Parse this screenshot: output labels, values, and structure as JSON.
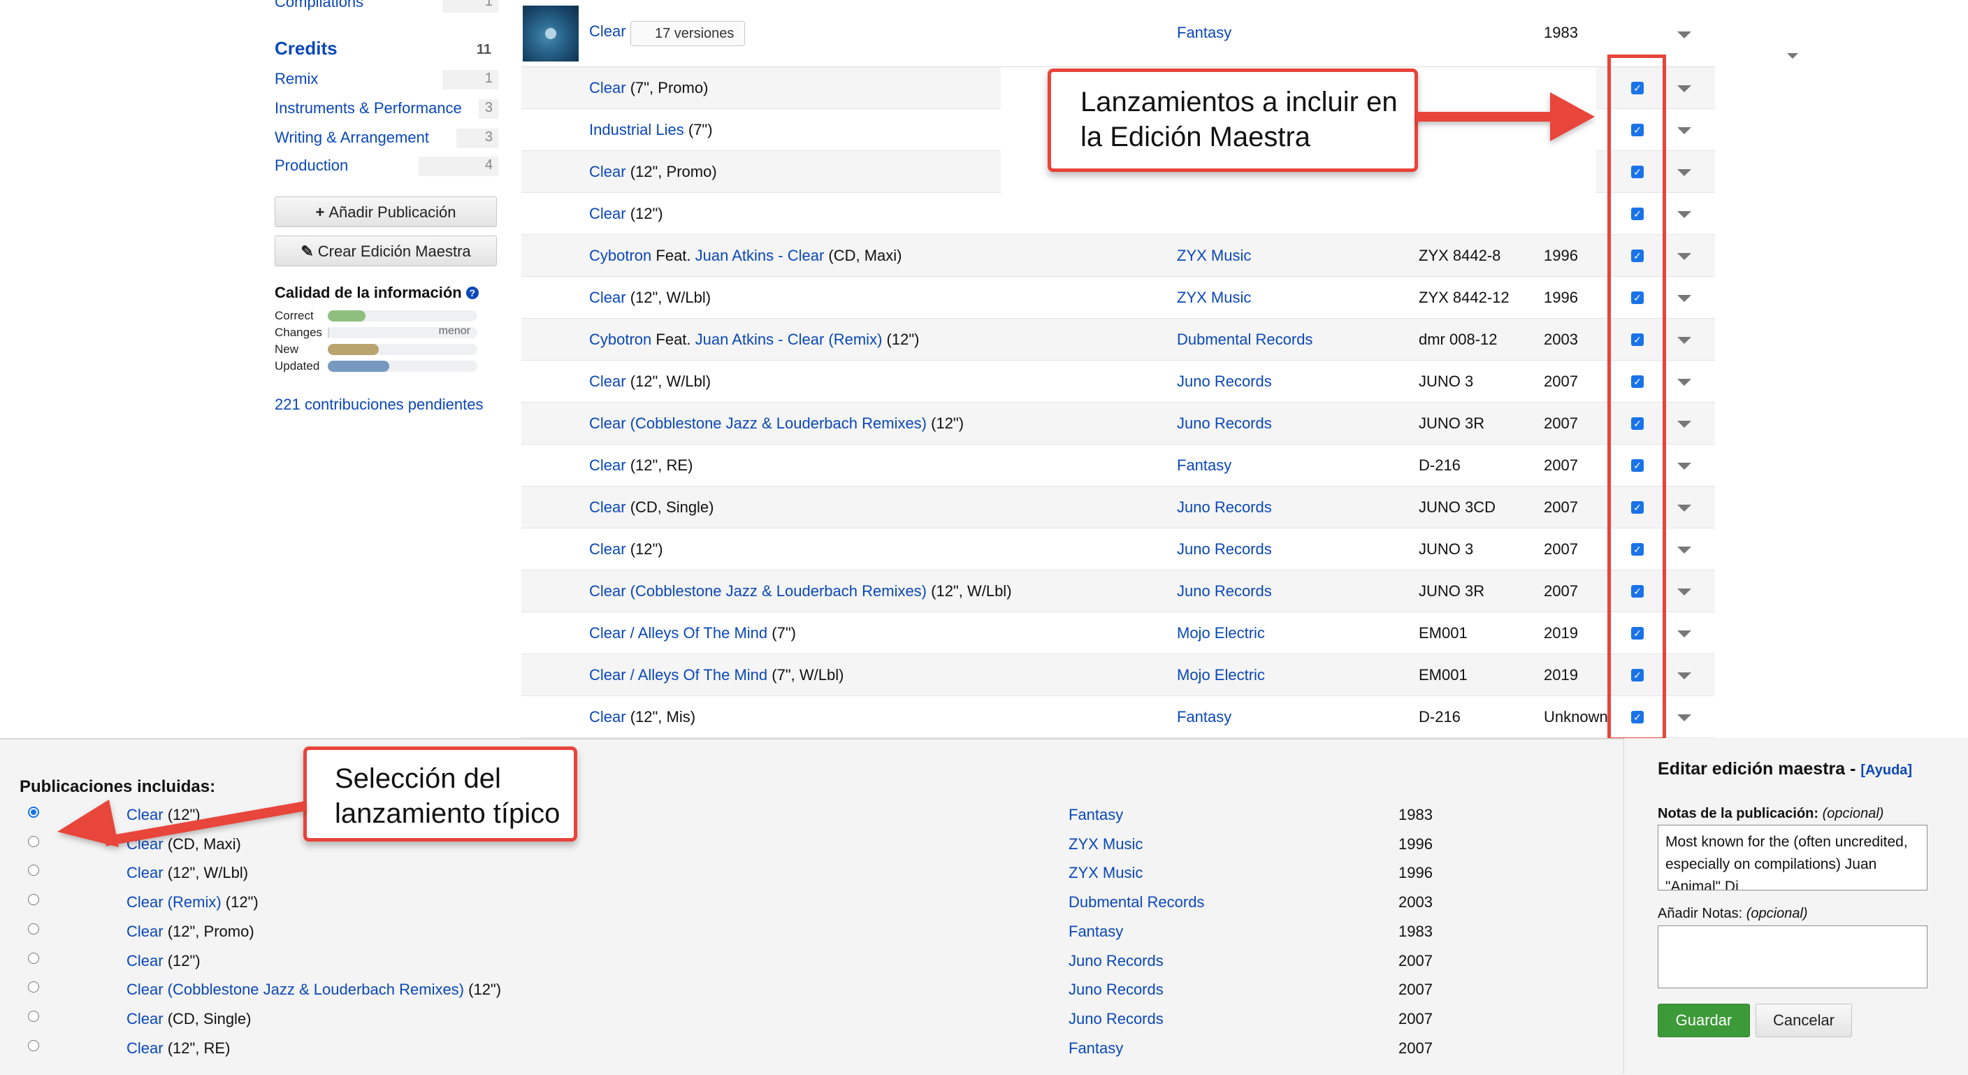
{
  "sidebar": {
    "compilations": {
      "label": "Compilations",
      "count": "1"
    },
    "credits": {
      "heading": "Credits",
      "count": "11"
    },
    "items": [
      {
        "label": "Remix",
        "count": "1"
      },
      {
        "label": "Instruments & Performance",
        "count": "3"
      },
      {
        "label": "Writing & Arrangement",
        "count": "3"
      },
      {
        "label": "Production",
        "count": "4"
      }
    ],
    "add_release_label": "Añadir Publicación",
    "create_master_label": "Crear Edición Maestra",
    "quality_heading": "Calidad de la información",
    "quality": [
      {
        "label": "Correct",
        "value": 0.25,
        "color": "#8fbf7f"
      },
      {
        "label": "Changes",
        "value": 0.0,
        "note": "menor",
        "color": "#d6d6d6"
      },
      {
        "label": "New",
        "value": 0.34,
        "color": "#b9a46e"
      },
      {
        "label": "Updated",
        "value": 0.41,
        "color": "#7799c0"
      }
    ],
    "pending_label": "221 contribuciones pendientes"
  },
  "master_row": {
    "title": "Clear",
    "versions_label": "17 versiones",
    "label": "Fantasy",
    "year": "1983"
  },
  "versions": [
    {
      "parts": [
        {
          "t": "Clear",
          "link": true
        },
        {
          "t": " (7\", Promo)"
        }
      ],
      "label": "",
      "cat": "",
      "year": ""
    },
    {
      "parts": [
        {
          "t": "Industrial Lies",
          "link": true
        },
        {
          "t": " (7\")"
        }
      ],
      "label": "",
      "cat": "",
      "year": ""
    },
    {
      "parts": [
        {
          "t": "Clear",
          "link": true
        },
        {
          "t": " (12\", Promo)"
        }
      ],
      "label": "",
      "cat": "",
      "year": ""
    },
    {
      "parts": [
        {
          "t": "Clear",
          "link": true
        },
        {
          "t": " (12\")"
        }
      ],
      "label": "",
      "cat": "",
      "year": ""
    },
    {
      "parts": [
        {
          "t": "Cybotron",
          "link": true
        },
        {
          "t": " Feat. "
        },
        {
          "t": "Juan Atkins",
          "link": true
        },
        {
          "t": " - ",
          "link": true
        },
        {
          "t": "Clear",
          "link": true
        },
        {
          "t": " (CD, Maxi)"
        }
      ],
      "label": "ZYX Music",
      "cat": "ZYX 8442-8",
      "year": "1996"
    },
    {
      "parts": [
        {
          "t": "Clear",
          "link": true
        },
        {
          "t": " (12\", W/Lbl)"
        }
      ],
      "label": "ZYX Music",
      "cat": "ZYX 8442-12",
      "year": "1996"
    },
    {
      "parts": [
        {
          "t": "Cybotron",
          "link": true
        },
        {
          "t": " Feat. "
        },
        {
          "t": "Juan Atkins",
          "link": true
        },
        {
          "t": " - ",
          "link": true
        },
        {
          "t": "Clear (Remix)",
          "link": true
        },
        {
          "t": " (12\")"
        }
      ],
      "label": "Dubmental Records",
      "cat": "dmr 008-12",
      "year": "2003"
    },
    {
      "parts": [
        {
          "t": "Clear",
          "link": true
        },
        {
          "t": " (12\", W/Lbl)"
        }
      ],
      "label": "Juno Records",
      "cat": "JUNO 3",
      "year": "2007"
    },
    {
      "parts": [
        {
          "t": "Clear (Cobblestone Jazz & Louderbach Remixes)",
          "link": true
        },
        {
          "t": " (12\")"
        }
      ],
      "label": "Juno Records",
      "cat": "JUNO 3R",
      "year": "2007"
    },
    {
      "parts": [
        {
          "t": "Clear",
          "link": true
        },
        {
          "t": " (12\", RE)"
        }
      ],
      "label": "Fantasy",
      "cat": "D-216",
      "year": "2007"
    },
    {
      "parts": [
        {
          "t": "Clear",
          "link": true
        },
        {
          "t": " (CD, Single)"
        }
      ],
      "label": "Juno Records",
      "cat": "JUNO 3CD",
      "year": "2007"
    },
    {
      "parts": [
        {
          "t": "Clear",
          "link": true
        },
        {
          "t": " (12\")"
        }
      ],
      "label": "Juno Records",
      "cat": "JUNO 3",
      "year": "2007"
    },
    {
      "parts": [
        {
          "t": "Clear (Cobblestone Jazz & Louderbach Remixes)",
          "link": true
        },
        {
          "t": " (12\", W/Lbl)"
        }
      ],
      "label": "Juno Records",
      "cat": "JUNO 3R",
      "year": "2007"
    },
    {
      "parts": [
        {
          "t": "Clear / Alleys Of The Mind",
          "link": true
        },
        {
          "t": " (7\")"
        }
      ],
      "label": "Mojo Electric",
      "cat": "EM001",
      "year": "2019"
    },
    {
      "parts": [
        {
          "t": "Clear / Alleys Of The Mind",
          "link": true
        },
        {
          "t": " (7\", W/Lbl)"
        }
      ],
      "label": "Mojo Electric",
      "cat": "EM001",
      "year": "2019"
    },
    {
      "parts": [
        {
          "t": "Clear",
          "link": true
        },
        {
          "t": " (12\", Mis)"
        }
      ],
      "label": "Fantasy",
      "cat": "D-216",
      "year": "Unknown"
    }
  ],
  "annotations": {
    "releases_to_include": "Lanzamientos a incluir en la Edición Maestra",
    "typical_release": "Selección del lanzamiento típico"
  },
  "included": {
    "heading": "Publicaciones incluidas:",
    "rows": [
      {
        "parts": [
          {
            "t": "Clear",
            "link": true
          },
          {
            "t": " (12\")"
          }
        ],
        "label": "Fantasy",
        "year": "1983",
        "selected": true
      },
      {
        "parts": [
          {
            "t": "Clear",
            "link": true
          },
          {
            "t": " (CD, Maxi)"
          }
        ],
        "label": "ZYX Music",
        "year": "1996"
      },
      {
        "parts": [
          {
            "t": "Clear",
            "link": true
          },
          {
            "t": " (12\", W/Lbl)"
          }
        ],
        "label": "ZYX Music",
        "year": "1996"
      },
      {
        "parts": [
          {
            "t": "Clear (Remix)",
            "link": true
          },
          {
            "t": " (12\")"
          }
        ],
        "label": "Dubmental Records",
        "year": "2003"
      },
      {
        "parts": [
          {
            "t": "Clear",
            "link": true
          },
          {
            "t": " (12\", Promo)"
          }
        ],
        "label": "Fantasy",
        "year": "1983"
      },
      {
        "parts": [
          {
            "t": "Clear",
            "link": true
          },
          {
            "t": " (12\")"
          }
        ],
        "label": "Juno Records",
        "year": "2007"
      },
      {
        "parts": [
          {
            "t": "Clear (Cobblestone Jazz & Louderbach Remixes)",
            "link": true
          },
          {
            "t": " (12\")"
          }
        ],
        "label": "Juno Records",
        "year": "2007"
      },
      {
        "parts": [
          {
            "t": "Clear",
            "link": true
          },
          {
            "t": " (CD, Single)"
          }
        ],
        "label": "Juno Records",
        "year": "2007"
      },
      {
        "parts": [
          {
            "t": "Clear",
            "link": true
          },
          {
            "t": " (12\", RE)"
          }
        ],
        "label": "Fantasy",
        "year": "2007"
      }
    ]
  },
  "edit_master": {
    "heading": "Editar edición maestra",
    "help": "[Ayuda]",
    "notes_label": "Notas de la publicación:",
    "optional": "(opcional)",
    "notes_value": "Most known for the (often uncredited, especially on compilations) Juan \"Animal\" Di",
    "add_notes_label": "Añadir Notas:",
    "save": "Guardar",
    "cancel": "Cancelar"
  },
  "colors": {
    "link": "#0a48b8",
    "annotation": "#e8443a",
    "checkbox": "#1a73e8",
    "save": "#3d9a38"
  }
}
